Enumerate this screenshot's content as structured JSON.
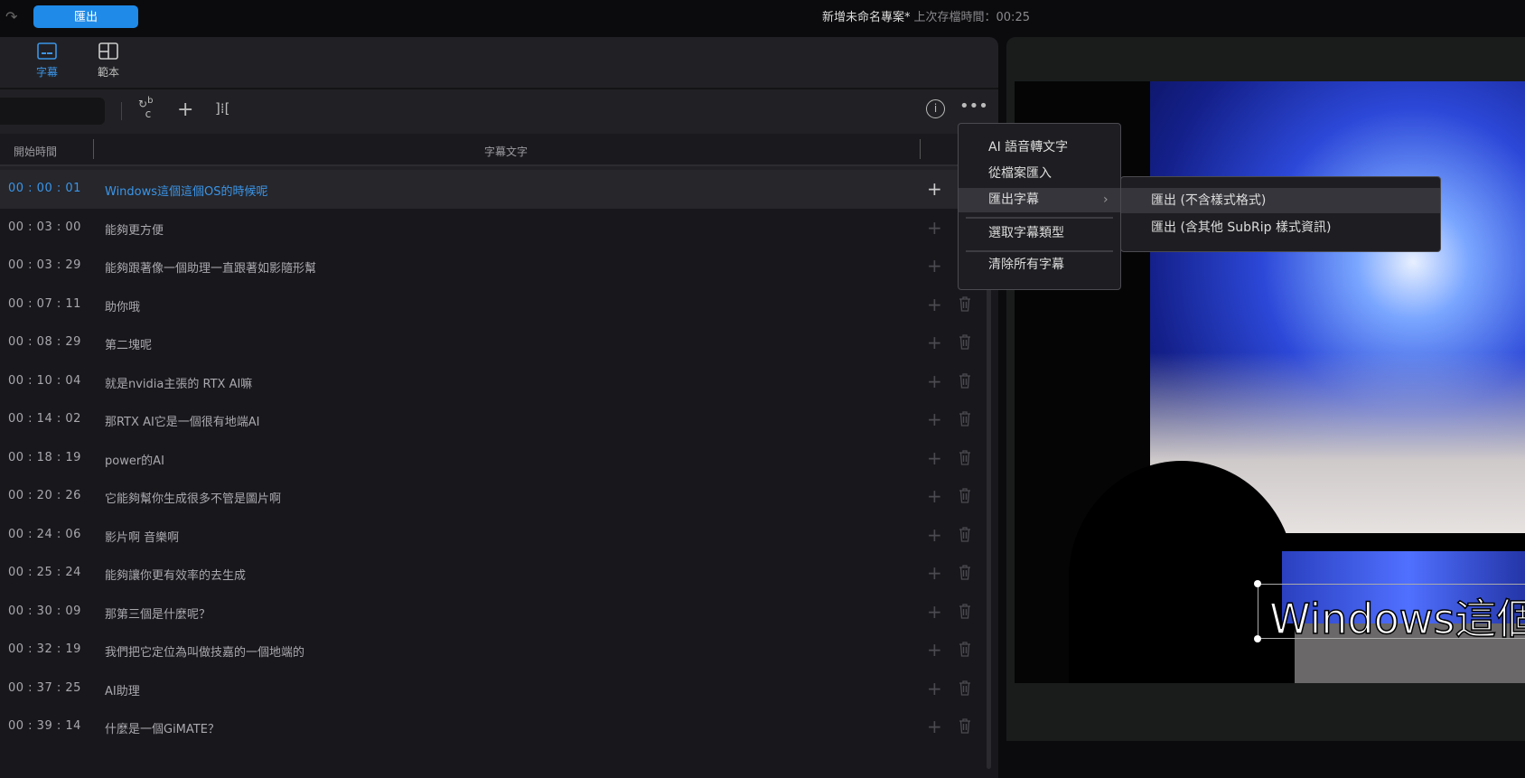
{
  "topbar": {
    "export_label": "匯出",
    "project_title": "新增未命名專案*",
    "last_saved": "上次存檔時間：00:25"
  },
  "tabs": [
    {
      "label": "字幕",
      "active": true
    },
    {
      "label": "範本",
      "active": false
    }
  ],
  "table": {
    "headers": [
      "開始時間",
      "字幕文字"
    ],
    "rows": [
      {
        "time": "00 : 00 : 01",
        "text": "Windows這個這個OS的時候呢"
      },
      {
        "time": "00 : 03 : 00",
        "text": "能夠更方便"
      },
      {
        "time": "00 : 03 : 29",
        "text": "能夠跟著像一個助理一直跟著如影隨形幫"
      },
      {
        "time": "00 : 07 : 11",
        "text": "助你哦"
      },
      {
        "time": "00 : 08 : 29",
        "text": "第二塊呢"
      },
      {
        "time": "00 : 10 : 04",
        "text": "就是nvidia主張的 RTX AI嘛"
      },
      {
        "time": "00 : 14 : 02",
        "text": "那RTX AI它是一個很有地端AI"
      },
      {
        "time": "00 : 18 : 19",
        "text": "power的AI"
      },
      {
        "time": "00 : 20 : 26",
        "text": "它能夠幫你生成很多不管是圖片啊"
      },
      {
        "time": "00 : 24 : 06",
        "text": "影片啊 音樂啊"
      },
      {
        "time": "00 : 25 : 24",
        "text": "能夠讓你更有效率的去生成"
      },
      {
        "time": "00 : 30 : 09",
        "text": "那第三個是什麼呢？"
      },
      {
        "time": "00 : 32 : 19",
        "text": "我們把它定位為叫做技嘉的一個地端的"
      },
      {
        "time": "00 : 37 : 25",
        "text": "AI助理"
      },
      {
        "time": "00 : 39 : 14",
        "text": "什麼是一個GiMATE？"
      }
    ]
  },
  "menu": {
    "items": [
      "AI 語音轉文字",
      "從檔案匯入",
      "匯出字幕",
      "選取字幕類型",
      "清除所有字幕"
    ],
    "submenu": [
      "匯出 (不含樣式格式)",
      "匯出 (含其他 SubRip 樣式資訊)"
    ]
  },
  "preview": {
    "caption": "Windows這個"
  },
  "colors": {
    "accent": "#1f8ae8"
  }
}
